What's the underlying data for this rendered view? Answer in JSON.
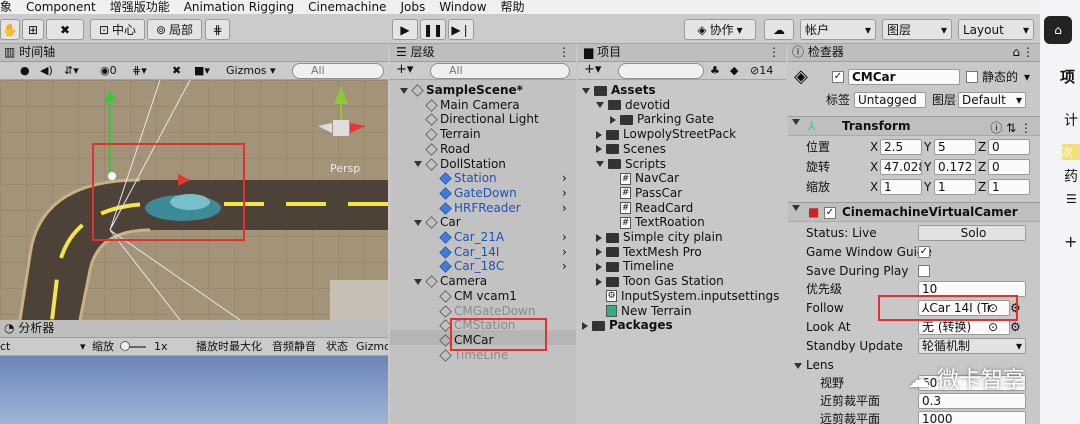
{
  "menu": [
    "象",
    "Component",
    "增强版功能",
    "Animation Rigging",
    "Cinemachine",
    "Jobs",
    "Window",
    "帮助"
  ],
  "toolbar": {
    "center": "中心",
    "local": "局部",
    "collab": "协作",
    "account": "帐户",
    "layers": "图层",
    "layout": "Layout"
  },
  "scene": {
    "tab": "时间轴",
    "gizmos": "Gizmos",
    "search": "All",
    "persp": "Persp"
  },
  "analyzer": {
    "tab": "分析器",
    "zoom": "缩放",
    "scale": "1x",
    "maximize": "播放时最大化",
    "mute": "音频静音",
    "stats": "状态",
    "gizmo": "Gizmo",
    "left": "ct"
  },
  "hierarchy": {
    "tab": "层级",
    "search": "All",
    "items": [
      {
        "label": "SampleScene*",
        "depth": 0,
        "bold": true
      },
      {
        "label": "Main Camera",
        "depth": 1
      },
      {
        "label": "Directional Light",
        "depth": 1
      },
      {
        "label": "Terrain",
        "depth": 1
      },
      {
        "label": "Road",
        "depth": 1
      },
      {
        "label": "DollStation",
        "depth": 1
      },
      {
        "label": "Station",
        "depth": 2,
        "blue": true
      },
      {
        "label": "GateDown",
        "depth": 2,
        "blue": true
      },
      {
        "label": "HRFReader",
        "depth": 2,
        "blue": true
      },
      {
        "label": "Car",
        "depth": 1
      },
      {
        "label": "Car_21A",
        "depth": 2,
        "blue": true
      },
      {
        "label": "Car_14I",
        "depth": 2,
        "blue": true
      },
      {
        "label": "Car_18C",
        "depth": 2,
        "blue": true
      },
      {
        "label": "Camera",
        "depth": 1
      },
      {
        "label": "CM vcam1",
        "depth": 2
      },
      {
        "label": "CMGateDown",
        "depth": 2,
        "gray": true
      },
      {
        "label": "CMStation",
        "depth": 2,
        "gray": true
      },
      {
        "label": "CMCar",
        "depth": 2
      },
      {
        "label": "TimeLine",
        "depth": 2,
        "gray": true
      }
    ]
  },
  "project": {
    "tab": "项目",
    "count": "14",
    "items": [
      {
        "label": "Assets",
        "depth": 0,
        "bold": true,
        "type": "folder-open"
      },
      {
        "label": "devotid",
        "depth": 1,
        "type": "folder-open"
      },
      {
        "label": "Parking Gate",
        "depth": 2,
        "type": "folder"
      },
      {
        "label": "LowpolyStreetPack",
        "depth": 1,
        "type": "folder"
      },
      {
        "label": "Scenes",
        "depth": 1,
        "type": "folder"
      },
      {
        "label": "Scripts",
        "depth": 1,
        "type": "folder-open"
      },
      {
        "label": "NavCar",
        "depth": 2,
        "type": "script"
      },
      {
        "label": "PassCar",
        "depth": 2,
        "type": "script"
      },
      {
        "label": "ReadCard",
        "depth": 2,
        "type": "script"
      },
      {
        "label": "TextRoation",
        "depth": 2,
        "type": "script"
      },
      {
        "label": "Simple city plain",
        "depth": 1,
        "type": "folder"
      },
      {
        "label": "TextMesh Pro",
        "depth": 1,
        "type": "folder"
      },
      {
        "label": "Timeline",
        "depth": 1,
        "type": "folder"
      },
      {
        "label": "Toon Gas Station",
        "depth": 1,
        "type": "folder"
      },
      {
        "label": "InputSystem.inputsettings",
        "depth": 1,
        "type": "asset"
      },
      {
        "label": "New Terrain",
        "depth": 1,
        "type": "terrain"
      },
      {
        "label": "Packages",
        "depth": 0,
        "bold": true,
        "type": "folder"
      }
    ]
  },
  "inspector": {
    "tab": "检查器",
    "name": "CMCar",
    "static": "静态的",
    "tag_label": "标签",
    "tag": "Untagged",
    "layer_label": "图层",
    "layer": "Default",
    "transform": {
      "title": "Transform",
      "pos_label": "位置",
      "rot_label": "旋转",
      "scale_label": "缩放",
      "pos": [
        "2.5",
        "5",
        "0"
      ],
      "rot": [
        "47.028",
        "0.172",
        "0"
      ],
      "scale": [
        "1",
        "1",
        "1"
      ],
      "x": "X",
      "y": "Y",
      "z": "Z"
    },
    "vcam": {
      "title": "CinemachineVirtualCamer",
      "status_label": "Status: Live",
      "solo": "Solo",
      "guides": "Game Window Guide",
      "save": "Save During Play",
      "priority_label": "优先级",
      "priority": "10",
      "follow_label": "Follow",
      "follow": "Car 14I (Tr",
      "lookat_label": "Look At",
      "lookat": "无 (转换)",
      "standby_label": "Standby Update",
      "standby": "轮循机制",
      "lens": "Lens",
      "fov": "视野",
      "fov_val": "60",
      "near": "近剪裁平面",
      "near_val": "0.3",
      "far": "远剪裁平面",
      "far_val": "1000"
    }
  },
  "right_sidebar": {
    "t1": "项",
    "t2": "计",
    "t3": "药",
    "badge": "次"
  },
  "watermark": "微卡智享"
}
